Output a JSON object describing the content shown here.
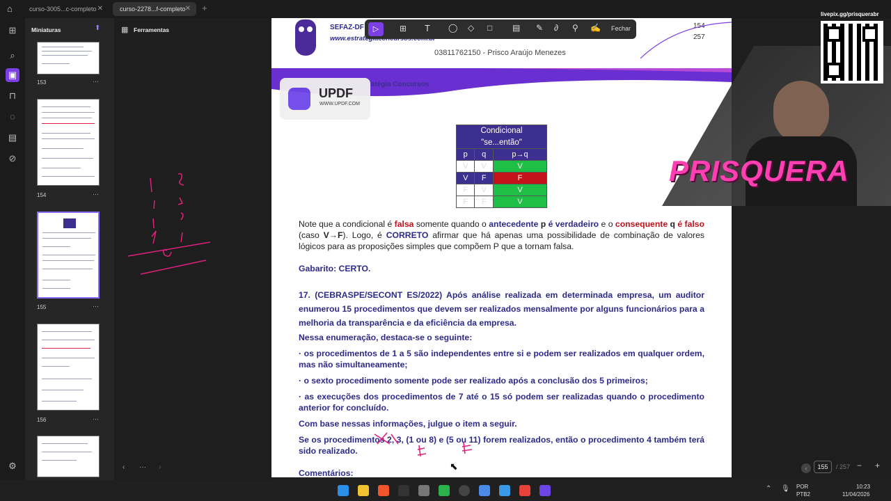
{
  "tabs": [
    {
      "label": "curso-3005...c-completo"
    },
    {
      "label": "curso-2278...f-completo"
    }
  ],
  "sidebar": {
    "title": "Miniaturas",
    "tools_label": "Ferramentas",
    "pages": [
      "153",
      "154",
      "155",
      "156"
    ]
  },
  "toolbar": {
    "close_label": "Fechar"
  },
  "header": {
    "brand": "SEFAZ-DF",
    "site": "www.estrategiaconcursos.com.br",
    "page_a": "154",
    "page_b": "257",
    "owner": "03811762150 - Prisco Araújo Menezes",
    "team": "Equipe Exatas Estratégia Concursos"
  },
  "updf": {
    "name": "UPDF",
    "url": "WWW.UPDF.COM"
  },
  "truth_table": {
    "title1": "Condicional",
    "title2": "\"se...então\"",
    "headers": [
      "p",
      "q",
      "p→q"
    ],
    "rows": [
      [
        "V",
        "V",
        "V"
      ],
      [
        "V",
        "F",
        "F"
      ],
      [
        "F",
        "V",
        "V"
      ],
      [
        "F",
        "F",
        "V"
      ]
    ]
  },
  "content": {
    "p1_a": "Note que a condicional é ",
    "p1_falsa": "falsa",
    "p1_b": " somente quando o ",
    "p1_antecedente": "antecedente",
    "p1_p": " p ",
    "p1_verdadeiro": "é verdadeiro",
    "p1_c": " e o ",
    "p1_consequente": "consequente",
    "p1_q": " q ",
    "p1_falso": "é falso",
    "p1_d": " (caso ",
    "p1_vf": "V→F",
    "p1_e": "). Logo, é ",
    "p1_correto": "CORRETO",
    "p1_f": " afirmar que há apenas uma possibilidade de combinação de valores lógicos para as proposições simples que compõem P que a tornam falsa.",
    "gabarito": "Gabarito: CERTO.",
    "q17": "17. (CEBRASPE/SECONT ES/2022) Após análise realizada em determinada empresa, um auditor enumerou 15 procedimentos que devem ser realizados mensalmente por alguns funcionários para a melhoria da transparência e da eficiência da empresa.",
    "destaca": "Nessa enumeração, destaca-se o seguinte:",
    "b1": "· os procedimentos de 1 a 5 são independentes entre si e podem ser realizados em qualquer ordem, mas não simultaneamente;",
    "b2": "· o sexto procedimento somente pode ser realizado após a conclusão dos 5 primeiros;",
    "b3": "· as execuções dos procedimentos de 7 até o 15 só podem ser realizadas quando o procedimento anterior for concluído.",
    "julgue": "Com base nessas informações, julgue o item a seguir.",
    "item": "Se os procedimentos 2, 3, (1 ou 8) e (5 ou 11) forem realizados, então o procedimento 4 também terá sido realizado.",
    "comentarios": "Comentários:"
  },
  "footer": {
    "page_input": "155",
    "page_total": "/ 257"
  },
  "stream": {
    "pix": "livepix.gg/prisquerabr",
    "overlay": "PRISQUERA"
  },
  "taskbar": {
    "lang1": "POR",
    "lang2": "PTB2",
    "time": "10:23",
    "date": "11/04/2026"
  },
  "colors": {
    "accent": "#7b3fe4",
    "doc_blue": "#2e2a8a",
    "doc_red": "#c0101c",
    "green": "#1fbf45"
  }
}
